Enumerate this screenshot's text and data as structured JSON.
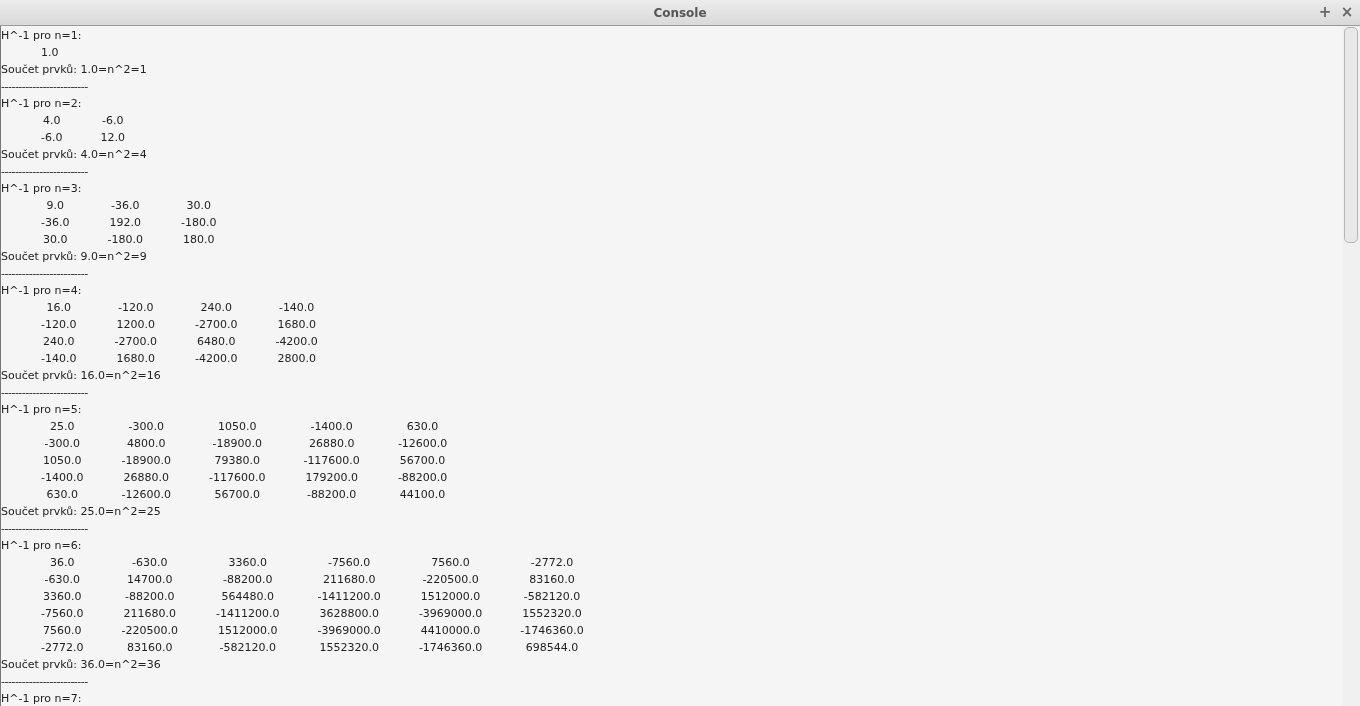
{
  "window": {
    "title": "Console"
  },
  "window_buttons": [
    "+",
    "×"
  ],
  "output": [
    {
      "header": "H^-1 pro n=1:",
      "rows": [
        [
          "1.0"
        ]
      ],
      "sum": "Součet prvků: 1.0=n^2=1",
      "separator": "-------------------------"
    },
    {
      "header": "H^-1 pro n=2:",
      "rows": [
        [
          "4.0",
          "-6.0"
        ],
        [
          "-6.0",
          "12.0"
        ]
      ],
      "sum": "Součet prvků: 4.0=n^2=4",
      "separator": "-------------------------"
    },
    {
      "header": "H^-1 pro n=3:",
      "rows": [
        [
          "9.0",
          "-36.0",
          "30.0"
        ],
        [
          "-36.0",
          "192.0",
          "-180.0"
        ],
        [
          "30.0",
          "-180.0",
          "180.0"
        ]
      ],
      "sum": "Součet prvků: 9.0=n^2=9",
      "separator": "-------------------------"
    },
    {
      "header": "H^-1 pro n=4:",
      "rows": [
        [
          "16.0",
          "-120.0",
          "240.0",
          "-140.0"
        ],
        [
          "-120.0",
          "1200.0",
          "-2700.0",
          "1680.0"
        ],
        [
          "240.0",
          "-2700.0",
          "6480.0",
          "-4200.0"
        ],
        [
          "-140.0",
          "1680.0",
          "-4200.0",
          "2800.0"
        ]
      ],
      "sum": "Součet prvků: 16.0=n^2=16",
      "separator": "-------------------------"
    },
    {
      "header": "H^-1 pro n=5:",
      "rows": [
        [
          "25.0",
          "-300.0",
          "1050.0",
          "-1400.0",
          "630.0"
        ],
        [
          "-300.0",
          "4800.0",
          "-18900.0",
          "26880.0",
          "-12600.0"
        ],
        [
          "1050.0",
          "-18900.0",
          "79380.0",
          "-117600.0",
          "56700.0"
        ],
        [
          "-1400.0",
          "26880.0",
          "-117600.0",
          "179200.0",
          "-88200.0"
        ],
        [
          "630.0",
          "-12600.0",
          "56700.0",
          "-88200.0",
          "44100.0"
        ]
      ],
      "sum": "Součet prvků: 25.0=n^2=25",
      "separator": "-------------------------"
    },
    {
      "header": "H^-1 pro n=6:",
      "rows": [
        [
          "36.0",
          "-630.0",
          "3360.0",
          "-7560.0",
          "7560.0",
          "-2772.0"
        ],
        [
          "-630.0",
          "14700.0",
          "-88200.0",
          "211680.0",
          "-220500.0",
          "83160.0"
        ],
        [
          "3360.0",
          "-88200.0",
          "564480.0",
          "-1411200.0",
          "1512000.0",
          "-582120.0"
        ],
        [
          "-7560.0",
          "211680.0",
          "-1411200.0",
          "3628800.0",
          "-3969000.0",
          "1552320.0"
        ],
        [
          "7560.0",
          "-220500.0",
          "1512000.0",
          "-3969000.0",
          "4410000.0",
          "-1746360.0"
        ],
        [
          "-2772.0",
          "83160.0",
          "-582120.0",
          "1552320.0",
          "-1746360.0",
          "698544.0"
        ]
      ],
      "sum": "Součet prvků: 36.0=n^2=36",
      "separator": "-------------------------"
    },
    {
      "header": "H^-1 pro n=7:"
    }
  ]
}
